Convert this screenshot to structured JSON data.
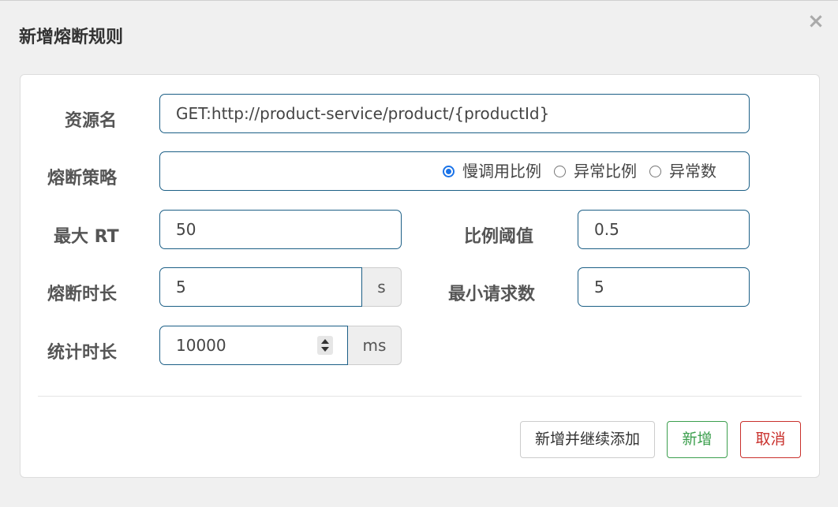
{
  "dialog": {
    "title": "新增熔断规则",
    "close_symbol": "×"
  },
  "form": {
    "resource_name": {
      "label": "资源名",
      "value": "GET:http://product-service/product/{productId}"
    },
    "strategy": {
      "label": "熔断策略",
      "options": [
        {
          "label": "慢调用比例",
          "checked": true
        },
        {
          "label": "异常比例",
          "checked": false
        },
        {
          "label": "异常数",
          "checked": false
        }
      ]
    },
    "max_rt": {
      "label": "最大 RT",
      "value": "50"
    },
    "ratio_threshold": {
      "label": "比例阈值",
      "value": "0.5"
    },
    "break_duration": {
      "label": "熔断时长",
      "value": "5",
      "unit": "s"
    },
    "min_request": {
      "label": "最小请求数",
      "value": "5"
    },
    "stat_duration": {
      "label": "统计时长",
      "value": "10000",
      "unit": "ms"
    }
  },
  "footer": {
    "add_continue_label": "新增并继续添加",
    "add_label": "新增",
    "cancel_label": "取消"
  },
  "colors": {
    "input_border": "#1c5f86",
    "radio_accent": "#1a73e8",
    "success": "#3c9f4e",
    "danger": "#c9302c"
  }
}
